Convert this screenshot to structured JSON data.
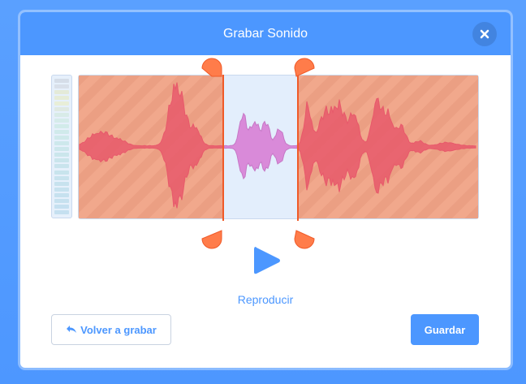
{
  "modal": {
    "title": "Grabar Sonido",
    "close_icon": "close-icon"
  },
  "editor": {
    "trim_selection": {
      "start_fraction": 0.36,
      "end_fraction": 0.55
    },
    "colors": {
      "trimmed_overlay": "#f2a486",
      "selected_bg": "#e3eefc",
      "waveform_trimmed": "#e8596b",
      "waveform_selected": "#d98ad9",
      "handle": "#ff7c4a",
      "handle_line": "#f05a28"
    },
    "play_icon": "play-icon",
    "play_label": "Reproducir"
  },
  "actions": {
    "rerecord_icon": "undo-arrow-icon",
    "rerecord_label": "Volver a grabar",
    "save_label": "Guardar"
  },
  "theme": {
    "accent": "#4c97ff",
    "background": "#4c97ff"
  }
}
